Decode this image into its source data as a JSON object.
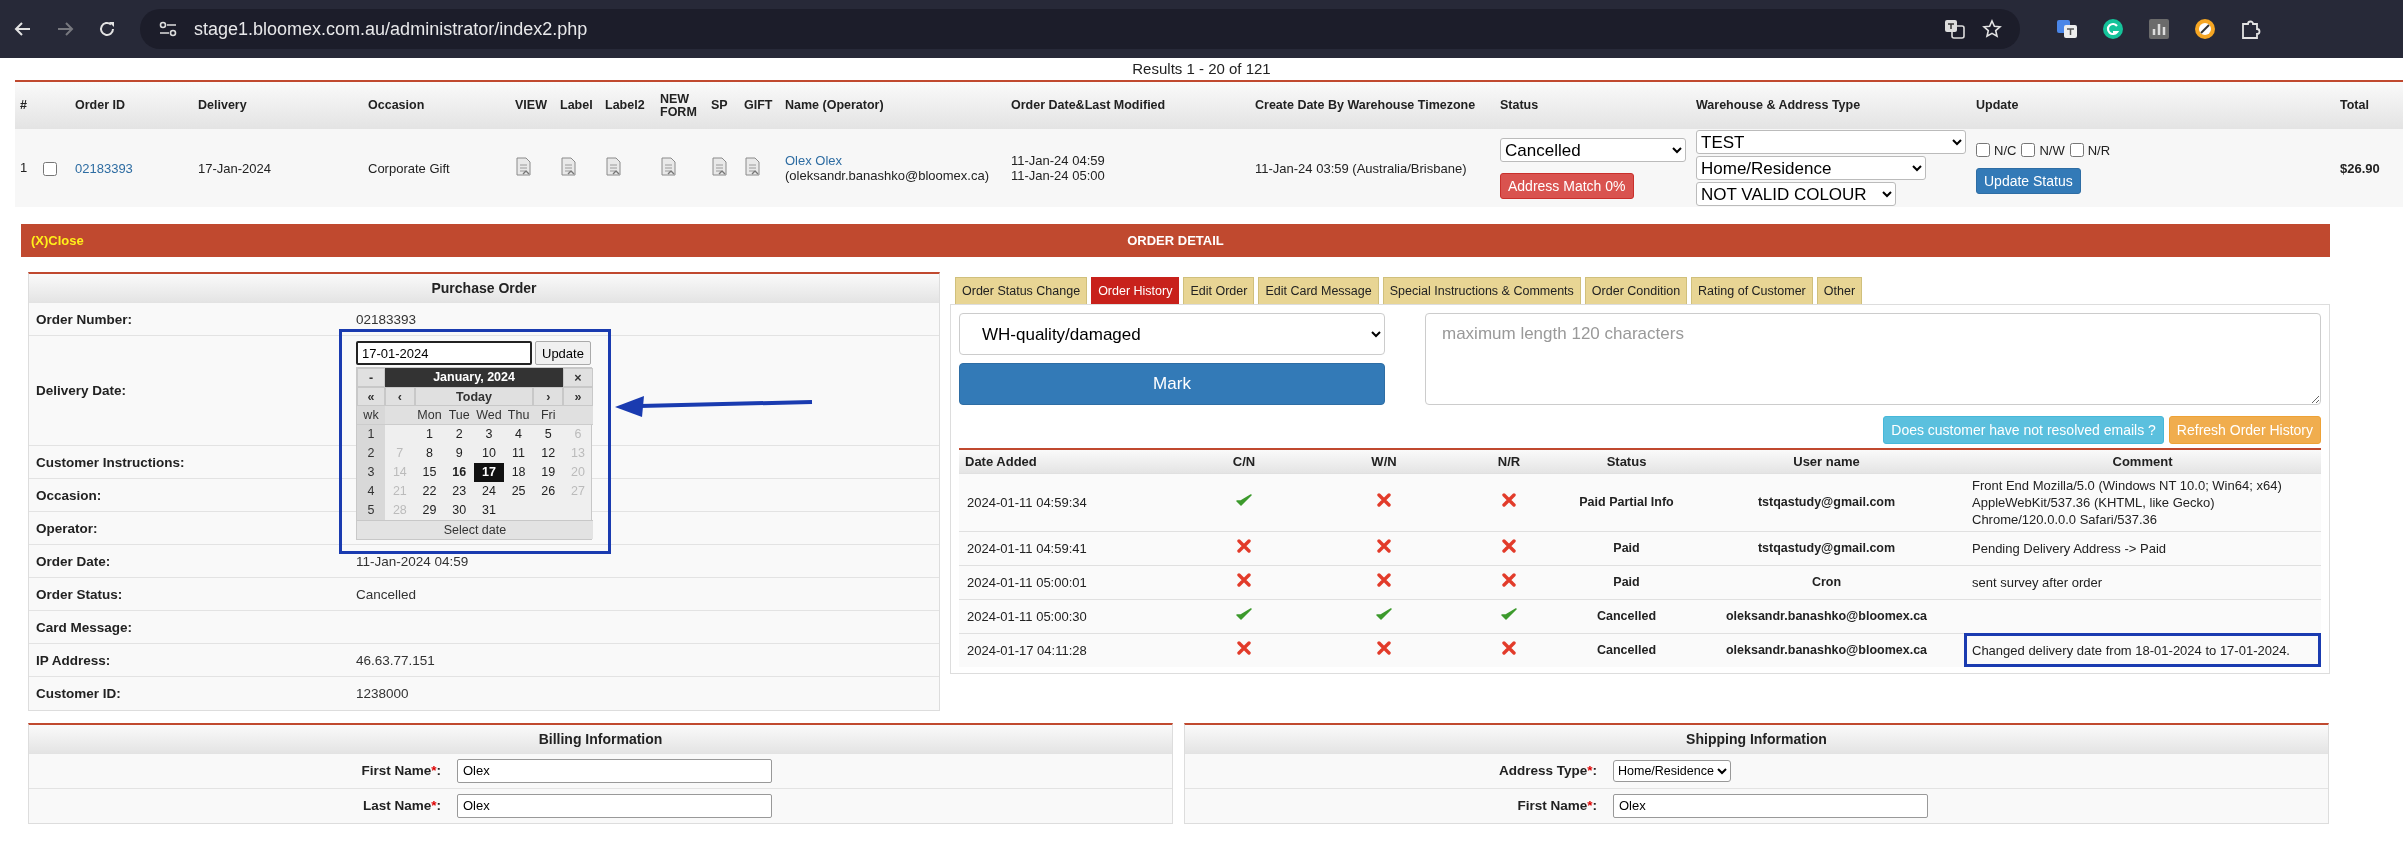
{
  "browser": {
    "url": "stage1.bloomex.com.au/administrator/index2.php"
  },
  "results": "Results 1 - 20 of 121",
  "orders": {
    "columns": [
      "#",
      "Order ID",
      "Delivery",
      "Occasion",
      "VIEW",
      "Label",
      "Label2",
      "NEW FORM",
      "SP",
      "GIFT",
      "Name (Operator)",
      "Order Date&Last Modified",
      "Create Date By Warehouse Timezone",
      "Status",
      "Warehouse & Address Type",
      "Update",
      "Total"
    ],
    "rows": [
      {
        "num": "1",
        "checked": false,
        "order_id": "02183393",
        "delivery": "17-Jan-2024",
        "occasion": "Corporate Gift",
        "name": "Olex Olex",
        "operator": "(oleksandr.banashko@bloomex.ca)",
        "order_dates": [
          "11-Jan-24 04:59",
          "11-Jan-24 05:00"
        ],
        "create_date": "11-Jan-24 03:59 (Australia/Brisbane)",
        "status": "Cancelled",
        "address_match": "Address Match 0%",
        "warehouse": "TEST",
        "address_type": "Home/Residence",
        "colour": "NOT VALID COLOUR",
        "update_flags": [
          {
            "label": "N/C",
            "checked": false
          },
          {
            "label": "N/W",
            "checked": false
          },
          {
            "label": "N/R",
            "checked": false
          }
        ],
        "update_button": "Update Status",
        "total": "$26.90"
      }
    ]
  },
  "detail": {
    "close": "(X)Close",
    "title": "ORDER DETAIL",
    "purchase_order": {
      "title": "Purchase Order",
      "fields": [
        {
          "kind": "text",
          "label": "Order Number:",
          "value": "02183393"
        },
        {
          "kind": "date_editor",
          "label": "Delivery Date:"
        },
        {
          "kind": "text",
          "label": "Customer Instructions:"
        },
        {
          "kind": "text",
          "label": "Occasion:"
        },
        {
          "kind": "text",
          "label": "Operator:"
        },
        {
          "kind": "text",
          "label": "Order Date:",
          "value": "11-Jan-2024 04:59"
        },
        {
          "kind": "text",
          "label": "Order Status:",
          "value": "Cancelled"
        },
        {
          "kind": "text",
          "label": "Card Message:"
        },
        {
          "kind": "text",
          "label": "IP Address:",
          "value": "46.63.77.151"
        },
        {
          "kind": "text",
          "label": "Customer ID:",
          "value": "1238000"
        }
      ]
    },
    "date_editor": {
      "value": "17-01-2024",
      "button": "Update",
      "calendar": {
        "minus": "-",
        "title": "January, 2024",
        "close": "×",
        "nav": [
          "«",
          "‹",
          "Today",
          "›",
          "»"
        ],
        "wk_label": "wk",
        "weekdays": [
          "Mon",
          "Tue",
          "Wed",
          "Thu",
          "Fri"
        ],
        "footer": "Select date",
        "weeks": [
          {
            "wk": "1",
            "days": [
              {
                "d": "1",
                "weekend": false,
                "today": false,
                "selected": false
              },
              {
                "d": "2",
                "weekend": false,
                "today": false,
                "selected": false
              },
              {
                "d": "3",
                "weekend": false,
                "today": false,
                "selected": false
              },
              {
                "d": "4",
                "weekend": false,
                "today": false,
                "selected": false
              },
              {
                "d": "5",
                "weekend": false,
                "today": false,
                "selected": false
              },
              {
                "d": "6",
                "weekend": true,
                "today": false,
                "selected": false
              }
            ]
          },
          {
            "wk": "2",
            "days": [
              {
                "d": "7",
                "weekend": true,
                "today": false,
                "selected": false
              },
              {
                "d": "8",
                "weekend": false,
                "today": false,
                "selected": false
              },
              {
                "d": "9",
                "weekend": false,
                "today": false,
                "selected": false
              },
              {
                "d": "10",
                "weekend": false,
                "today": false,
                "selected": false
              },
              {
                "d": "11",
                "weekend": false,
                "today": false,
                "selected": false
              },
              {
                "d": "12",
                "weekend": false,
                "today": false,
                "selected": false
              },
              {
                "d": "13",
                "weekend": true,
                "today": false,
                "selected": false
              }
            ]
          },
          {
            "wk": "3",
            "days": [
              {
                "d": "14",
                "weekend": true,
                "today": false,
                "selected": false
              },
              {
                "d": "15",
                "weekend": false,
                "today": false,
                "selected": false
              },
              {
                "d": "16",
                "weekend": false,
                "today": true,
                "selected": false
              },
              {
                "d": "17",
                "weekend": false,
                "today": false,
                "selected": true
              },
              {
                "d": "18",
                "weekend": false,
                "today": false,
                "selected": false
              },
              {
                "d": "19",
                "weekend": false,
                "today": false,
                "selected": false
              },
              {
                "d": "20",
                "weekend": true,
                "today": false,
                "selected": false
              }
            ]
          },
          {
            "wk": "4",
            "days": [
              {
                "d": "21",
                "weekend": true,
                "today": false,
                "selected": false
              },
              {
                "d": "22",
                "weekend": false,
                "today": false,
                "selected": false
              },
              {
                "d": "23",
                "weekend": false,
                "today": false,
                "selected": false
              },
              {
                "d": "24",
                "weekend": false,
                "today": false,
                "selected": false
              },
              {
                "d": "25",
                "weekend": false,
                "today": false,
                "selected": false
              },
              {
                "d": "26",
                "weekend": false,
                "today": false,
                "selected": false
              },
              {
                "d": "27",
                "weekend": true,
                "today": false,
                "selected": false
              }
            ]
          },
          {
            "wk": "5",
            "days": [
              {
                "d": "28",
                "weekend": true,
                "today": false,
                "selected": false
              },
              {
                "d": "29",
                "weekend": false,
                "today": false,
                "selected": false
              },
              {
                "d": "30",
                "weekend": false,
                "today": false,
                "selected": false
              },
              {
                "d": "31",
                "weekend": false,
                "today": false,
                "selected": false
              }
            ]
          }
        ]
      }
    },
    "annotation": {
      "frame_around_calendar": true,
      "arrow_to_calendar": true
    },
    "tabs": [
      {
        "label": "Order Status Change",
        "selected": false
      },
      {
        "label": "Order History",
        "selected": true
      },
      {
        "label": "Edit Order",
        "selected": false
      },
      {
        "label": "Edit Card Message",
        "selected": false
      },
      {
        "label": "Special Instructions & Comments",
        "selected": false
      },
      {
        "label": "Order Condition",
        "selected": false
      },
      {
        "label": "Rating of Customer",
        "selected": false
      },
      {
        "label": "Other",
        "selected": false
      }
    ],
    "reason_select": "WH-quality/damaged",
    "mark_button": "Mark",
    "comment_placeholder": "maximum length 120 characters",
    "emails_button": "Does customer have not resolved emails ?",
    "refresh_button": "Refresh Order History",
    "history": {
      "columns": [
        "Date Added",
        "C/N",
        "W/N",
        "N/R",
        "Status",
        "User name",
        "Comment"
      ],
      "rows": [
        {
          "date": "2024-01-11 04:59:34",
          "cn": true,
          "wn": false,
          "nr": false,
          "status": "Paid Partial Info",
          "user": "tstqastudy@gmail.com",
          "comment": "Front End Mozilla/5.0 (Windows NT 10.0; Win64; x64) AppleWebKit/537.36 (KHTML, like Gecko) Chrome/120.0.0.0 Safari/537.36",
          "highlighted": false
        },
        {
          "date": "2024-01-11 04:59:41",
          "cn": false,
          "wn": false,
          "nr": false,
          "status": "Paid",
          "user": "tstqastudy@gmail.com",
          "comment": "Pending Delivery Address -> Paid",
          "highlighted": false
        },
        {
          "date": "2024-01-11 05:00:01",
          "cn": false,
          "wn": false,
          "nr": false,
          "status": "Paid",
          "user": "Cron",
          "comment": "sent survey after order",
          "highlighted": false
        },
        {
          "date": "2024-01-11 05:00:30",
          "cn": true,
          "wn": true,
          "nr": true,
          "status": "Cancelled",
          "user": "oleksandr.banashko@bloomex.ca",
          "highlighted": false
        },
        {
          "date": "2024-01-17 04:11:28",
          "cn": false,
          "wn": false,
          "nr": false,
          "status": "Cancelled",
          "user": "oleksandr.banashko@bloomex.ca",
          "comment": "Changed delivery date from 18-01-2024 to 17-01-2024.",
          "highlighted": true
        }
      ]
    }
  },
  "billing": {
    "title": "Billing Information",
    "fields": [
      {
        "kind": "text",
        "label": "First Name",
        "mark": "*",
        "end": ":",
        "value": "Olex"
      },
      {
        "kind": "text",
        "label": "Last Name",
        "mark": "*",
        "end": ":",
        "value": "Olex"
      }
    ]
  },
  "shipping": {
    "title": "Shipping Information",
    "fields": [
      {
        "kind": "select",
        "label": "Address Type",
        "mark": "*",
        "end": ":",
        "value": "Home/Residence"
      },
      {
        "kind": "text",
        "label": "First Name",
        "mark": "*",
        "end": ":",
        "value": "Olex"
      }
    ]
  }
}
